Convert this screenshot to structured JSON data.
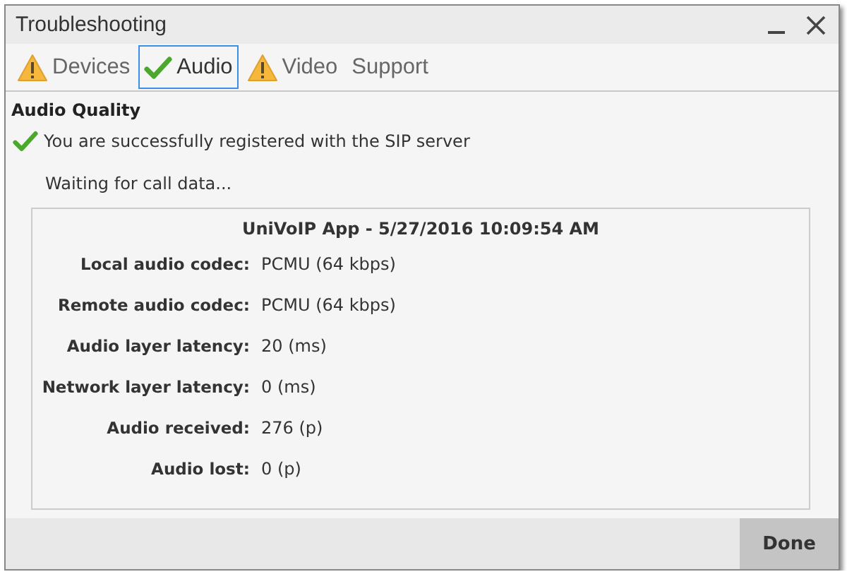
{
  "window": {
    "title": "Troubleshooting"
  },
  "tabs": [
    {
      "label": "Devices",
      "kind": "warning",
      "selected": false
    },
    {
      "label": "Audio",
      "kind": "ok",
      "selected": true
    },
    {
      "label": "Video",
      "kind": "warning",
      "selected": false
    },
    {
      "label": "Support",
      "kind": "plain",
      "selected": false
    }
  ],
  "section_title": "Audio Quality",
  "registration": {
    "kind": "ok",
    "text": "You are successfully registered with the SIP server"
  },
  "waiting_text": "Waiting for call data...",
  "report": {
    "header": "UniVoIP App - 5/27/2016 10:09:54 AM",
    "rows": [
      {
        "label": "Local audio codec:",
        "value": "PCMU (64 kbps)"
      },
      {
        "label": "Remote audio codec:",
        "value": "PCMU (64 kbps)"
      },
      {
        "label": "Audio layer latency:",
        "value": "20 (ms)"
      },
      {
        "label": "Network layer latency:",
        "value": "0 (ms)"
      },
      {
        "label": "Audio received:",
        "value": "276 (p)"
      },
      {
        "label": "Audio lost:",
        "value": "0 (p)"
      }
    ]
  },
  "buttons": [
    {
      "label": "Done"
    }
  ]
}
